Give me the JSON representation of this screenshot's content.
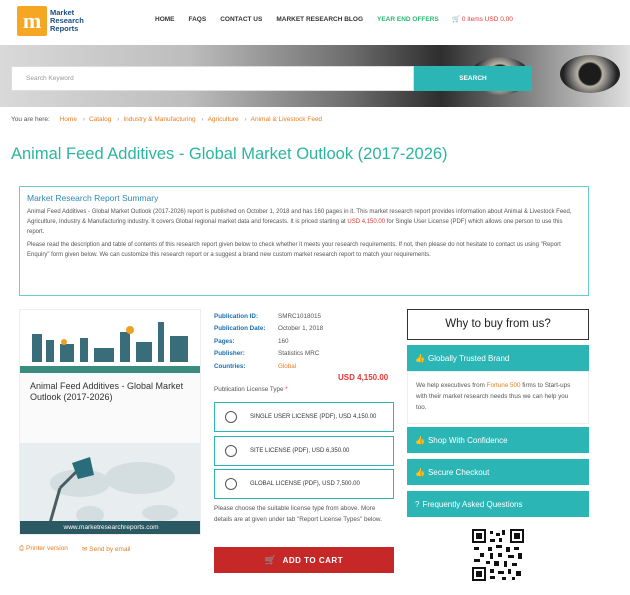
{
  "header": {
    "logo_letter": "m",
    "logo_text_1": "Market",
    "logo_text_2": "Research",
    "logo_text_3": "Reports",
    "nav": [
      "HOME",
      "FAQS",
      "CONTACT US",
      "MARKET RESEARCH BLOG",
      "YEAR END OFFERS"
    ],
    "cart_text": "0 items USD 0.00"
  },
  "search": {
    "placeholder": "Search Keyword",
    "button": "SEARCH"
  },
  "breadcrumb": {
    "prefix": "You are here:",
    "items": [
      "Home",
      "Catalog",
      "Industry & Manufacturing",
      "Agriculture",
      "Animal & Livestock Feed"
    ]
  },
  "title": "Animal Feed Additives - Global Market Outlook (2017-2026)",
  "summary": {
    "heading": "Market Research Report Summary",
    "p1_a": "Animal Feed Additives - Global Market Outlook (2017-2026) report is published on October 1, 2018 and has 160 pages in it. This market research report provides information about Animal & Livestock Feed, Agriculture, Industry & Manufacturing industry. It covers Global regional market data and forecasts. It is priced starting at ",
    "p1_price": "USD 4,150.00",
    "p1_b": " for Single User License (PDF) which allows one person to use this report.",
    "p2": "Please read the description and table of contents of this research report given below to check whether it meets your research requirements. If not, then please do not hesitate to contact us using \"Report Enquiry\" form given below. We can customize this research report or a suggest a brand new custom market research report to match your requirements."
  },
  "cover": {
    "title": "Animal Feed Additives - Global Market Outlook (2017-2026)",
    "url": "www.marketresearchreports.com"
  },
  "links": {
    "print": "Printer version",
    "email": "Send by email"
  },
  "details": {
    "rows": [
      {
        "k": "Publication ID:",
        "v": "SMRC1018015"
      },
      {
        "k": "Publication Date:",
        "v": "October 1, 2018"
      },
      {
        "k": "Pages:",
        "v": "160"
      },
      {
        "k": "Publisher:",
        "v": "Statistics MRC"
      },
      {
        "k": "Countries:",
        "v": "Global"
      }
    ],
    "price": "USD 4,150.00",
    "license_label": "Publication License Type",
    "required_mark": "*"
  },
  "licenses": [
    "SINGLE USER LICENSE (PDF), USD 4,150.00",
    "SITE LICENSE (PDF), USD 6,350.00",
    "GLOBAL LICENSE (PDF), USD 7,500.00"
  ],
  "license_note": "Please choose the suitable license type from above. More details are at given under tab \"Report License Types\" below.",
  "add_to_cart": "ADD TO CART",
  "why": {
    "heading": "Why to buy from us?",
    "trusted": "Globally Trusted Brand",
    "trust_a": "We help executives from ",
    "trust_hl": "Fortune 500",
    "trust_b": " firms to Start-ups with their market research needs thus we can help you too.",
    "shop": "Shop With Confidence",
    "secure": "Secure Checkout",
    "faq": "Frequently Asked Questions"
  },
  "colors": {
    "teal": "#2bb5b5",
    "orange": "#e67e22",
    "red": "#c62828",
    "green": "#2bb673"
  }
}
